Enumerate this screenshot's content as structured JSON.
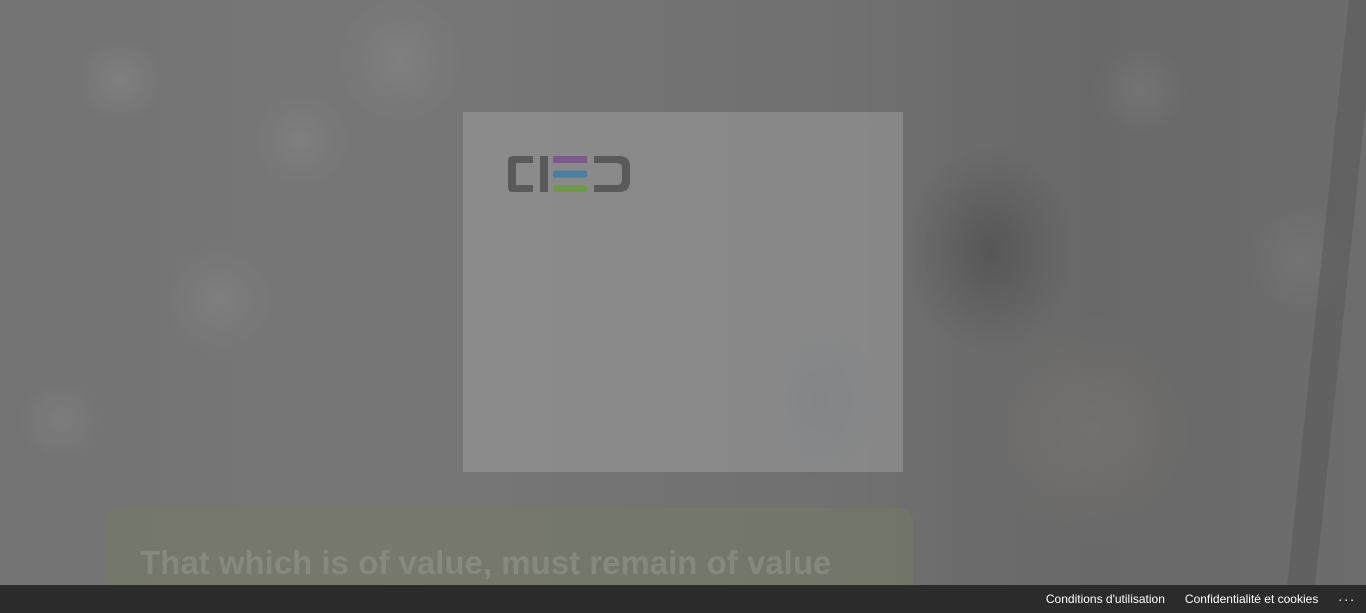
{
  "hero": {
    "tagline": "That which is of value, must remain of value"
  },
  "modal": {
    "logo": {
      "text": "CED",
      "icon": "ced-logo",
      "colors": {
        "letters": "#5a5a5a",
        "bar_top": "#7b5a8a",
        "bar_middle": "#4a7fa0",
        "bar_bottom": "#6f9a4a"
      }
    }
  },
  "footer": {
    "terms_label": "Conditions d'utilisation",
    "privacy_label": "Confidentialité et cookies",
    "more_label": "...",
    "more_icon": "ellipsis-icon"
  }
}
